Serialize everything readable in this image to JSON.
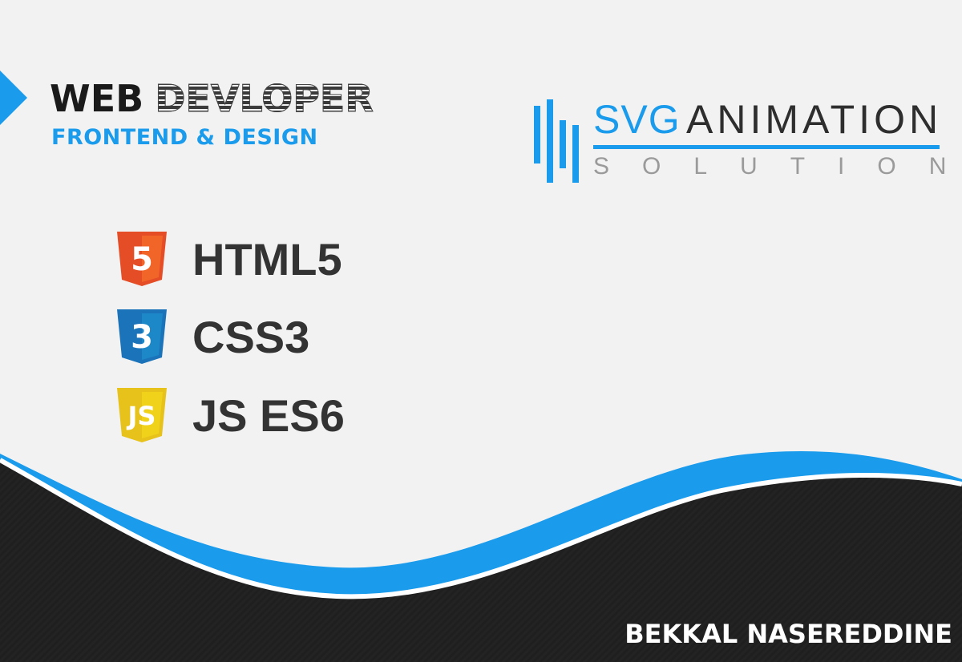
{
  "header": {
    "title_bold": "WEB",
    "title_outline": "DEVLOPER",
    "subtitle": "FRONTEND & DESIGN"
  },
  "logo": {
    "word1": "SVG",
    "word2": "ANIMATION",
    "tagline": "SOLUTION"
  },
  "technologies": [
    {
      "label": "HTML5",
      "icon": "html5-shield-icon",
      "color": "#e44d26",
      "glyph": "5"
    },
    {
      "label": "CSS3",
      "icon": "css3-shield-icon",
      "color": "#1b73ba",
      "glyph": "3"
    },
    {
      "label": "JS ES6",
      "icon": "js-shield-icon",
      "color": "#f0d21b",
      "glyph": "JS"
    }
  ],
  "footer": {
    "author": "BEKKAL NASEREDDINE"
  },
  "colors": {
    "accent": "#1a9bec",
    "dark": "#1e1e1e",
    "background": "#f2f2f2"
  }
}
